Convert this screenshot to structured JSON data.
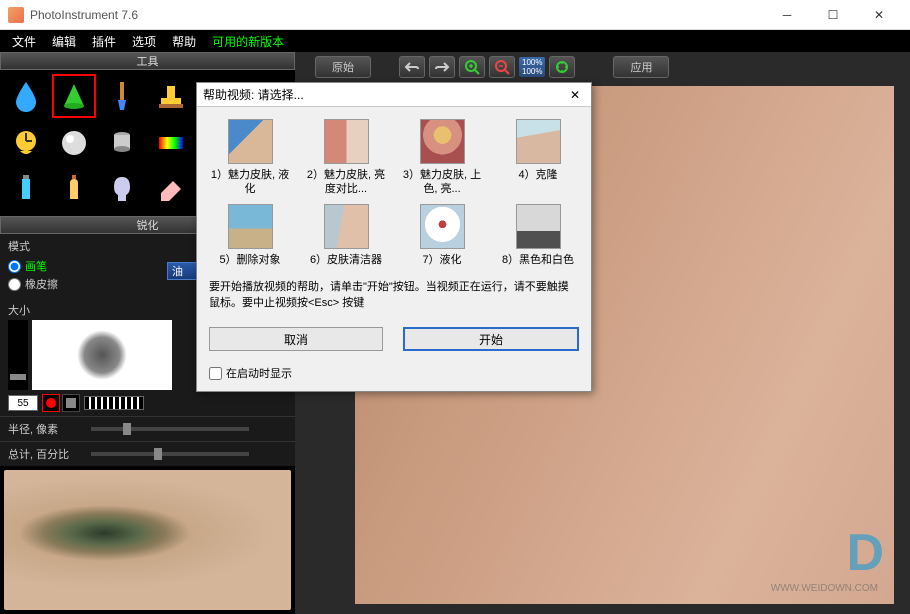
{
  "window": {
    "title": "PhotoInstrument 7.6"
  },
  "menu": {
    "file": "文件",
    "edit": "编辑",
    "plugin": "插件",
    "options": "选项",
    "help": "帮助",
    "new_version": "可用的新版本"
  },
  "panels": {
    "tools_title": "工具",
    "sharpen_title": "锐化"
  },
  "mode": {
    "label": "模式",
    "brush": "画笔",
    "eraser": "橡皮擦",
    "combo": "油"
  },
  "size": {
    "label": "大小",
    "value": "55"
  },
  "sliders": {
    "radius_label": "半径, 像素",
    "radius_val": "",
    "total_label": "总计, 百分比",
    "total_val": ""
  },
  "toolbar": {
    "original": "原始",
    "apply": "应用",
    "zoom1": "100%",
    "zoom2": "100%"
  },
  "dialog": {
    "title": "帮助视频: 请选择...",
    "videos": [
      {
        "label": "1）魅力皮肤, 液化"
      },
      {
        "label": "2）魅力皮肤, 亮度对比..."
      },
      {
        "label": "3）魅力皮肤, 上色, 亮..."
      },
      {
        "label": "4）克隆"
      },
      {
        "label": "5）删除对象"
      },
      {
        "label": "6）皮肤清洁器"
      },
      {
        "label": "7）液化"
      },
      {
        "label": "8）黑色和白色"
      }
    ],
    "message": "要开始播放视频的帮助，请单击\"开始\"按钮。当视频正在运行，请不要触摸鼠标。要中止视频按<Esc> 按键",
    "cancel": "取消",
    "start": "开始",
    "show_startup": "在启动时显示"
  },
  "watermark": {
    "url": "WWW.WEIDOWN.COM"
  }
}
